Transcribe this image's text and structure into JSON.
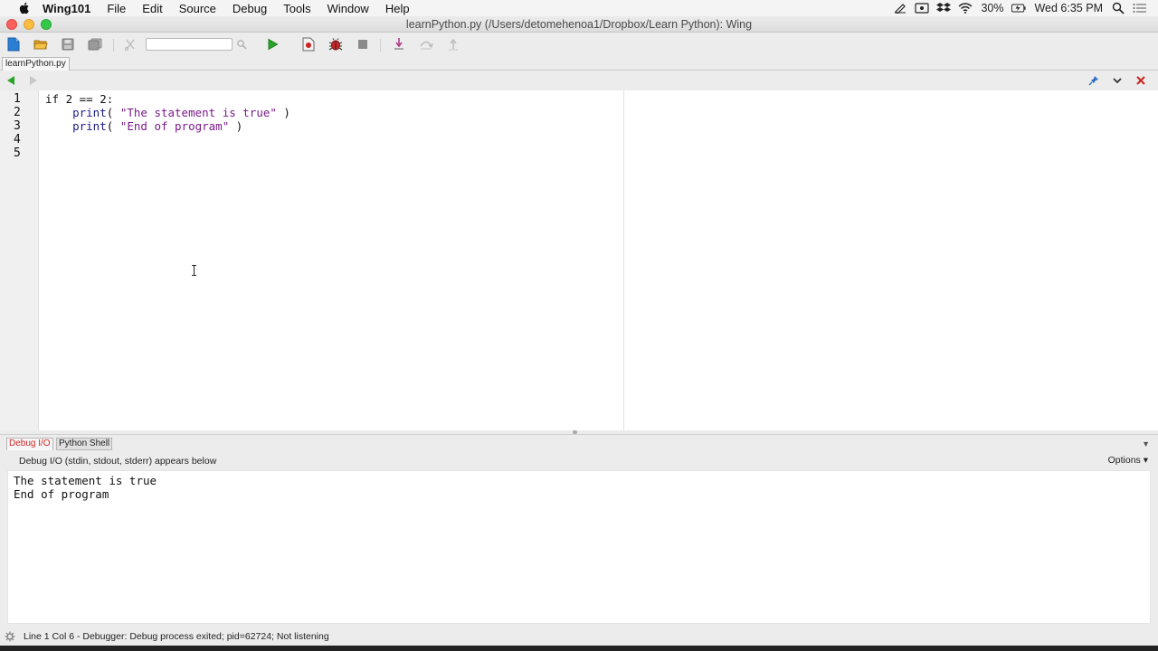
{
  "menubar": {
    "app_name": "Wing101",
    "items": [
      "File",
      "Edit",
      "Source",
      "Debug",
      "Tools",
      "Window",
      "Help"
    ],
    "battery": "30%",
    "clock": "Wed 6:35 PM"
  },
  "window": {
    "title": "learnPython.py (/Users/detomehenoa1/Dropbox/Learn Python): Wing"
  },
  "toolbar": {
    "search_value": "",
    "icons": [
      "new-file-icon",
      "open-folder-icon",
      "save-icon",
      "save-all-icon",
      "cut-icon",
      "search-icon",
      "run-icon",
      "breakpoint-icon",
      "debug-icon",
      "stop-icon",
      "step-into-icon",
      "step-over-icon",
      "step-out-icon"
    ]
  },
  "editor": {
    "tab_label": "learnPython.py",
    "line_numbers": [
      "1",
      "2",
      "3",
      "4",
      "5"
    ],
    "lines": [
      [
        {
          "t": "if 2 == 2:",
          "c": "kw"
        }
      ],
      [
        {
          "t": "    ",
          "c": "kw"
        },
        {
          "t": "print",
          "c": "fn"
        },
        {
          "t": "( ",
          "c": "kw"
        },
        {
          "t": "\"The statement is true\"",
          "c": "str"
        },
        {
          "t": " )",
          "c": "kw"
        }
      ],
      [
        {
          "t": "    ",
          "c": "kw"
        },
        {
          "t": "print",
          "c": "fn"
        },
        {
          "t": "( ",
          "c": "kw"
        },
        {
          "t": "\"End of program\"",
          "c": "str"
        },
        {
          "t": " )",
          "c": "kw"
        }
      ],
      [],
      []
    ]
  },
  "panel": {
    "tabs": [
      "Debug I/O",
      "Python Shell"
    ],
    "active_tab": "Debug I/O",
    "description": "Debug I/O (stdin, stdout, stderr) appears below",
    "options_label": "Options",
    "output_lines": [
      "The statement is true",
      "End of program"
    ]
  },
  "status": {
    "message": "Line 1 Col 6 - Debugger: Debug process exited; pid=62724; Not listening"
  },
  "colors": {
    "string": "#7a1a8a",
    "function": "#1a1a8a",
    "active_tab": "#d42424",
    "run": "#2aa52a",
    "close": "#cc2222"
  }
}
